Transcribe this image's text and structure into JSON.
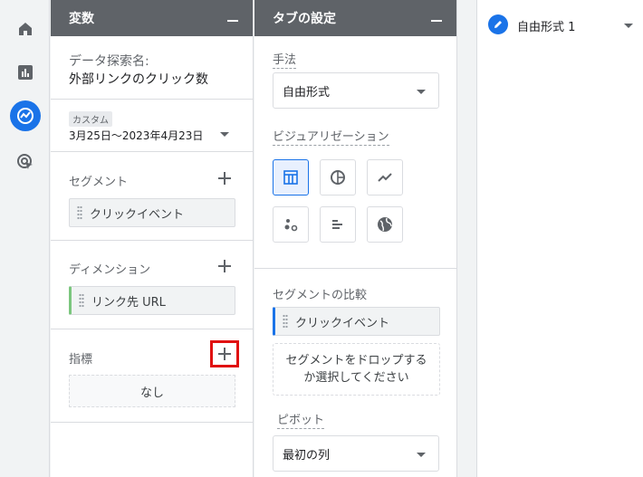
{
  "variables_panel": {
    "title": "変数",
    "exploration_name_label": "データ探索名:",
    "exploration_name": "外部リンクのクリック数",
    "date_range_tag": "カスタム",
    "date_range": "3月25日～2023年4月23日",
    "segment_label": "セグメント",
    "segment_chip": "クリックイベント",
    "dimension_label": "ディメンション",
    "dimension_chip": "リンク先 URL",
    "metric_label": "指標",
    "metric_empty": "なし"
  },
  "tab_settings_panel": {
    "title": "タブの設定",
    "technique_label": "手法",
    "technique_value": "自由形式",
    "visualization_label": "ビジュアリゼーション",
    "visualizations": [
      "table-icon",
      "donut-chart-icon",
      "line-chart-icon",
      "scatter-icon",
      "bar-chart-icon",
      "globe-icon"
    ],
    "segment_compare_label": "セグメントの比較",
    "segment_compare_chip": "クリックイベント",
    "drop_zone_text": "セグメントをドロップするか選択してください",
    "pivot_label": "ピボット",
    "pivot_value": "最初の列"
  },
  "canvas": {
    "tab_name": "自由形式 1"
  },
  "colors": {
    "accent": "#1a73e8",
    "header": "#5f6368",
    "highlight": "#e01010",
    "dimension_bar": "#7bc67e"
  }
}
